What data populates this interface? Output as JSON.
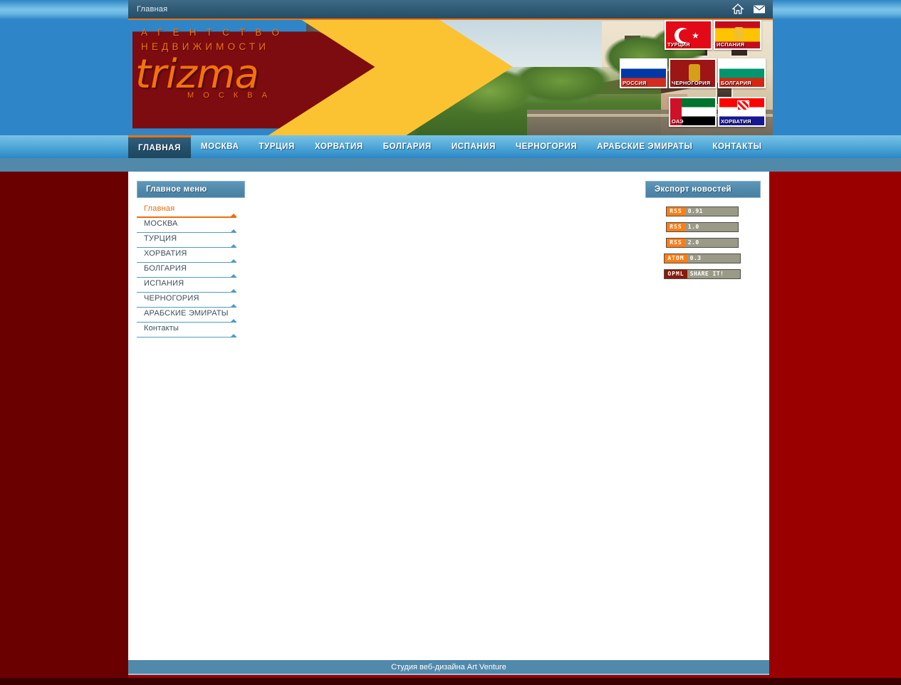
{
  "window": {
    "title": "Главная",
    "icons": [
      {
        "name": "home-icon",
        "glyph": "home"
      },
      {
        "name": "mail-icon",
        "glyph": "envelope"
      }
    ]
  },
  "branding": {
    "line1": "А Г Е Н Т С Т В О",
    "line2": "НЕДВИЖИМОСТИ",
    "wordmark": "trizma",
    "city": "М О С К В А"
  },
  "flags": [
    {
      "code": "tr",
      "label": "ТУРЦИЯ"
    },
    {
      "code": "es",
      "label": "ИСПАНИЯ"
    },
    {
      "code": "ru",
      "label": "РОССИЯ"
    },
    {
      "code": "me",
      "label": "ЧЕРНОГОРИЯ"
    },
    {
      "code": "bg",
      "label": "БОЛГАРИЯ"
    },
    {
      "code": "ae",
      "label": "ОАЭ"
    },
    {
      "code": "hr",
      "label": "ХОРВАТИЯ"
    }
  ],
  "nav": {
    "items": [
      {
        "label": "ГЛАВНАЯ",
        "active": true
      },
      {
        "label": "МОСКВА",
        "active": false
      },
      {
        "label": "ТУРЦИЯ",
        "active": false
      },
      {
        "label": "ХОРВАТИЯ",
        "active": false
      },
      {
        "label": "БОЛГАРИЯ",
        "active": false
      },
      {
        "label": "ИСПАНИЯ",
        "active": false
      },
      {
        "label": "ЧЕРНОГОРИЯ",
        "active": false
      },
      {
        "label": "АРАБСКИЕ ЭМИРАТЫ",
        "active": false
      },
      {
        "label": "КОНТАКТЫ",
        "active": false
      }
    ]
  },
  "sidebar": {
    "title": "Главное меню",
    "items": [
      {
        "label": "Главная",
        "active": true
      },
      {
        "label": "МОСКВА",
        "active": false
      },
      {
        "label": "ТУРЦИЯ",
        "active": false
      },
      {
        "label": "ХОРВАТИЯ",
        "active": false
      },
      {
        "label": "БОЛГАРИЯ",
        "active": false
      },
      {
        "label": "ИСПАНИЯ",
        "active": false
      },
      {
        "label": "ЧЕРНОГОРИЯ",
        "active": false
      },
      {
        "label": "АРАБСКИЕ ЭМИРАТЫ",
        "active": false
      },
      {
        "label": "Контакты",
        "active": false
      }
    ]
  },
  "export": {
    "title": "Экспорт новостей",
    "feeds": [
      {
        "kind": "RSS",
        "value": "0.91",
        "style": "rss"
      },
      {
        "kind": "RSS",
        "value": "1.0",
        "style": "rss"
      },
      {
        "kind": "RSS",
        "value": "2.0",
        "style": "rss"
      },
      {
        "kind": "ATOM",
        "value": "0.3",
        "style": "rss"
      },
      {
        "kind": "OPML",
        "value": "SHARE IT!",
        "style": "opml"
      }
    ]
  },
  "footer": {
    "text": "Студия веб-дизайна Art Venture"
  },
  "colors": {
    "accent_orange": "#f2720c",
    "brand_blue": "#2e86c8",
    "steel_blue": "#5189ab",
    "page_red": "#9a0000",
    "page_red_dark": "#6b0000",
    "logo_yellow": "#fbc332",
    "logo_darkred": "#7c0c10"
  }
}
